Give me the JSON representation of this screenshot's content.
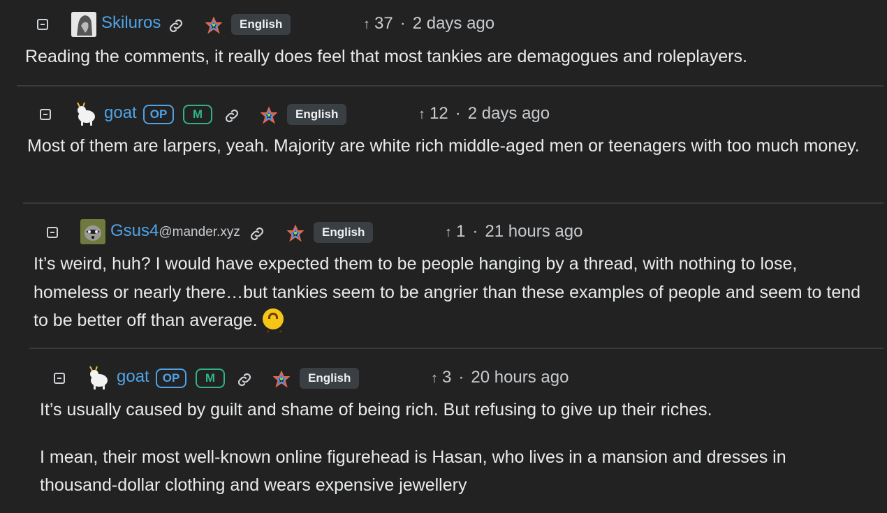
{
  "comments": [
    {
      "username": "Skiluros",
      "instance": "",
      "badges": [],
      "language": "English",
      "score": "37",
      "time": "2 days ago",
      "avatar_icon": "statue-avatar",
      "body": [
        "Reading the comments, it really does feel that most tankies are demagogues and roleplayers."
      ]
    },
    {
      "username": "goat",
      "instance": "",
      "badges": [
        "OP",
        "M"
      ],
      "language": "English",
      "score": "12",
      "time": "2 days ago",
      "avatar_icon": "goat-avatar",
      "body": [
        "Most of them are larpers, yeah. Majority are white rich middle-aged men or teenagers with too much money."
      ]
    },
    {
      "username": "Gsus4",
      "instance": "@mander.xyz",
      "badges": [],
      "language": "English",
      "score": "1",
      "time": "21 hours ago",
      "avatar_icon": "raccoon-avatar",
      "body": [
        "It’s weird, huh? I would have expected them to be people hanging by a thread, with nothing to lose, homeless or nearly there…but tankies seem to be angrier than these examples of people and seem to tend to be better off than average."
      ]
    },
    {
      "username": "goat",
      "instance": "",
      "badges": [
        "OP",
        "M"
      ],
      "language": "English",
      "score": "3",
      "time": "20 hours ago",
      "avatar_icon": "goat-avatar",
      "body": [
        "It’s usually caused by guilt and shame of being rich. But refusing to give up their riches.",
        "I mean, their most well-known online figurehead is Hasan, who lives in a mansion and dresses in thousand-dollar clothing and wears expensive jewellery"
      ]
    }
  ],
  "colors": {
    "background": "#222222",
    "username": "#4fa3e8",
    "op_badge": "#4fa3e8",
    "mod_badge": "#2fb48a",
    "thread_line_1": "#7a3a3a",
    "thread_line_2": "#5c5c33",
    "thread_line_3": "#5a6b3a"
  },
  "icons": {
    "collapse": "collapse-minus-icon",
    "link": "link-icon",
    "language": "rainbow-star-icon",
    "upvote": "arrow-up-icon",
    "emoji": "upside-down-face-emoji"
  }
}
